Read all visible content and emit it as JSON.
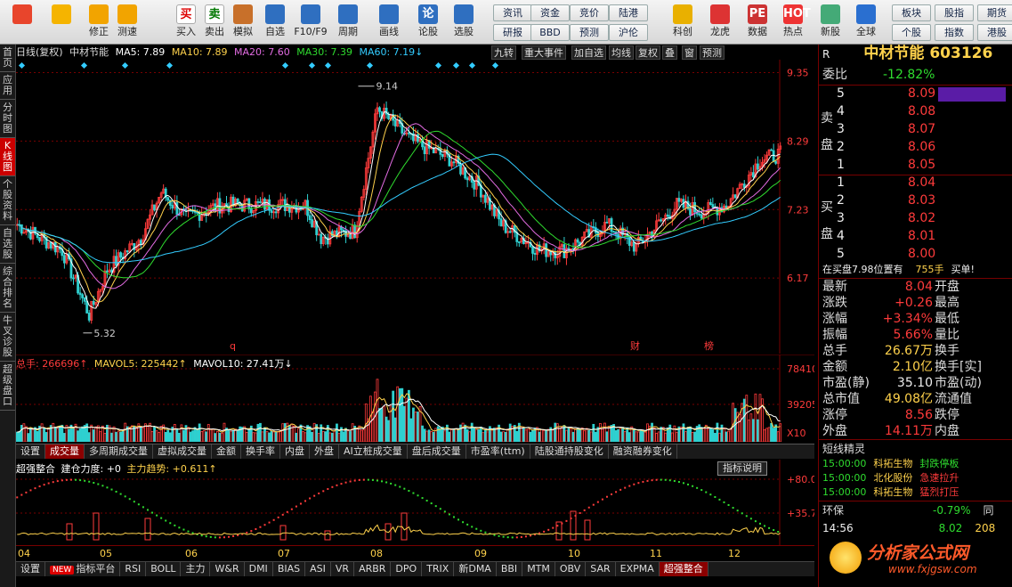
{
  "toolbar": {
    "buttons": [
      {
        "label": "",
        "icon": "grid-icon"
      },
      {
        "label": "",
        "icon": "back-arrow-icon"
      },
      {
        "label": "修正",
        "icon": "up-down-arrows-icon"
      },
      {
        "label": "测速",
        "icon": "clock-icon"
      },
      {
        "label": "买入",
        "icon": "buy-icon",
        "glyph": "买"
      },
      {
        "label": "卖出",
        "icon": "sell-icon",
        "glyph": "卖"
      },
      {
        "label": "模拟",
        "icon": "hammer-icon"
      },
      {
        "label": "自选",
        "icon": "star-icon"
      },
      {
        "label": "F10/F9",
        "icon": "f10-icon"
      },
      {
        "label": "周期",
        "icon": "period-icon"
      },
      {
        "label": "画线",
        "icon": "pen-icon"
      },
      {
        "label": "论股",
        "icon": "discuss-icon",
        "glyph": "论"
      },
      {
        "label": "选股",
        "icon": "select-stock-icon"
      },
      {
        "label": "科创",
        "icon": "kechuang-icon"
      },
      {
        "label": "龙虎",
        "icon": "dragon-tiger-icon"
      },
      {
        "label": "数据",
        "icon": "pe-icon",
        "glyph": "PE"
      },
      {
        "label": "热点",
        "icon": "hot-icon",
        "glyph": "HOT"
      },
      {
        "label": "新股",
        "icon": "new-stock-icon"
      },
      {
        "label": "全球",
        "icon": "globe-icon"
      }
    ],
    "small": [
      "资讯",
      "资金",
      "竞价",
      "陆港",
      "研报",
      "BBD",
      "预测",
      "沪伦",
      "板块",
      "股指",
      "期货",
      "个股",
      "指数",
      "港股"
    ]
  },
  "sidebar": [
    "首页",
    "应用",
    "分时图",
    "K线图",
    "个股资料",
    "自选股",
    "综合排名",
    "牛叉诊股",
    "超级盘口"
  ],
  "chart_head": {
    "period": "日线(复权)",
    "name": "中材节能",
    "ma5": "MA5: 7.89",
    "ma10": "MA10: 7.89",
    "ma20": "MA20: 7.60",
    "ma30": "MA30: 7.39",
    "ma60": "MA60: 7.19↓"
  },
  "chart_controls": [
    "九转",
    "重大事件",
    "加自选",
    "均线",
    "复权",
    "叠",
    "窗",
    "预测"
  ],
  "chart_data": {
    "type": "candlestick",
    "y_ticks": [
      "9.35",
      "8.29",
      "7.23",
      "6.17"
    ],
    "high_label": "9.14",
    "low_label": "5.32",
    "markers": [
      "q",
      "财",
      "榜"
    ],
    "months": [
      "04",
      "05",
      "06",
      "07",
      "08",
      "09",
      "10",
      "11",
      "12"
    ]
  },
  "vol_head": {
    "total": "总手: 266696↑",
    "mavol5": "MAVOL5: 225442↑",
    "mavol10": "MAVOL10: 27.41万↓",
    "ticks": [
      "78410",
      "39205",
      "X10"
    ]
  },
  "vol_tabs": [
    "设置",
    "成交量",
    "多周期成交量",
    "虚拟成交量",
    "金额",
    "换手率",
    "内盘",
    "外盘",
    "AI立桩成交量",
    "盘后成交量",
    "市盈率(ttm)",
    "陆股通持股变化",
    "融资融券变化"
  ],
  "ind_head": {
    "name": "超强整合",
    "build": "建仓力度: +0",
    "trend": "主力趋势: +0.611↑",
    "btn": "指标说明",
    "ticks": [
      "+80.03",
      "+35.74"
    ]
  },
  "bottom_tabs": {
    "new": "NEW",
    "items": [
      "设置",
      "指标平台",
      "RSI",
      "BOLL",
      "主力",
      "W&R",
      "DMI",
      "BIAS",
      "ASI",
      "VR",
      "ARBR",
      "DPO",
      "TRIX",
      "新DMA",
      "BBI",
      "MTM",
      "OBV",
      "SAR",
      "EXPMA",
      "超强整合"
    ]
  },
  "quote": {
    "r": "R",
    "name": "中材节能",
    "code": "603126",
    "weibi_label": "委比",
    "weibi": "-12.82%",
    "sell": [
      {
        "n": "5",
        "p": "8.09"
      },
      {
        "n": "4",
        "p": "8.08"
      },
      {
        "n": "3",
        "p": "8.07"
      },
      {
        "n": "2",
        "p": "8.06"
      },
      {
        "n": "1",
        "p": "8.05"
      }
    ],
    "buy": [
      {
        "n": "1",
        "p": "8.04"
      },
      {
        "n": "2",
        "p": "8.03"
      },
      {
        "n": "3",
        "p": "8.02"
      },
      {
        "n": "4",
        "p": "8.01"
      },
      {
        "n": "5",
        "p": "8.00"
      }
    ],
    "sell_label": "卖盘",
    "buy_label": "买盘",
    "notice": "在买盘7.98位置有",
    "notice_hands": "755手",
    "notice_buy": "买单!",
    "fields": [
      {
        "l": "最新",
        "v": "8.04",
        "l2": "开盘"
      },
      {
        "l": "涨跌",
        "v": "+0.26",
        "l2": "最高"
      },
      {
        "l": "涨幅",
        "v": "+3.34%",
        "l2": "最低"
      },
      {
        "l": "振幅",
        "v": "5.66%",
        "l2": "量比"
      },
      {
        "l": "总手",
        "v": "26.67万",
        "l2": "换手"
      },
      {
        "l": "金额",
        "v": "2.10亿",
        "l2": "换手[实]"
      },
      {
        "l": "市盈(静)",
        "v": "35.10",
        "l2": "市盈(动)"
      },
      {
        "l": "总市值",
        "v": "49.08亿",
        "l2": "流通值"
      },
      {
        "l": "涨停",
        "v": "8.56",
        "l2": "跌停"
      },
      {
        "l": "外盘",
        "v": "14.11万",
        "l2": "内盘"
      }
    ],
    "short_title": "短线精灵",
    "short": [
      {
        "t": "15:00:00",
        "s": "科拓生物",
        "e": "封跌停板"
      },
      {
        "t": "15:00:00",
        "s": "北化股份",
        "e": "急速拉升"
      },
      {
        "t": "15:00:00",
        "s": "科拓生物",
        "e": "猛烈打压"
      }
    ],
    "huanping": "环保",
    "huanping_v": "-0.79%",
    "huanping_r": "同",
    "time": "14:56",
    "last": "8.02",
    "vol": "208"
  },
  "watermark": {
    "main": "分析家公式网",
    "url": "www.fxjgsw.com"
  }
}
